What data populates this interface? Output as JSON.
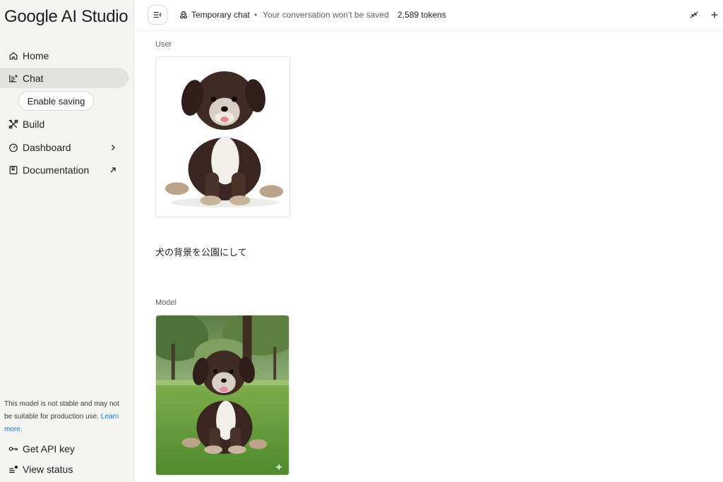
{
  "sidebar": {
    "logo": "Google AI Studio",
    "items": [
      {
        "label": "Home",
        "icon": "home-icon"
      },
      {
        "label": "Chat",
        "icon": "chat-spark-icon"
      },
      {
        "label": "Build",
        "icon": "build-icon"
      },
      {
        "label": "Dashboard",
        "icon": "dashboard-icon"
      },
      {
        "label": "Documentation",
        "icon": "book-icon"
      }
    ],
    "enable_saving": "Enable saving",
    "disclaimer": "This model is not stable and may not be suitable for production use.",
    "learn_more": "Learn more.",
    "get_api_key": "Get API key",
    "view_status": "View status"
  },
  "topbar": {
    "temp_label": "Temporary chat",
    "bullet": "•",
    "save_note": "Your conversation won't be saved",
    "tokens": "2,589 tokens"
  },
  "chat": {
    "user_role": "User",
    "user_prompt": "犬の背景を公園にして",
    "model_role": "Model"
  },
  "colors": {
    "sidebar_bg": "#f4f4f3",
    "active_item": "#e2e2e0",
    "link": "#1a73e8"
  }
}
